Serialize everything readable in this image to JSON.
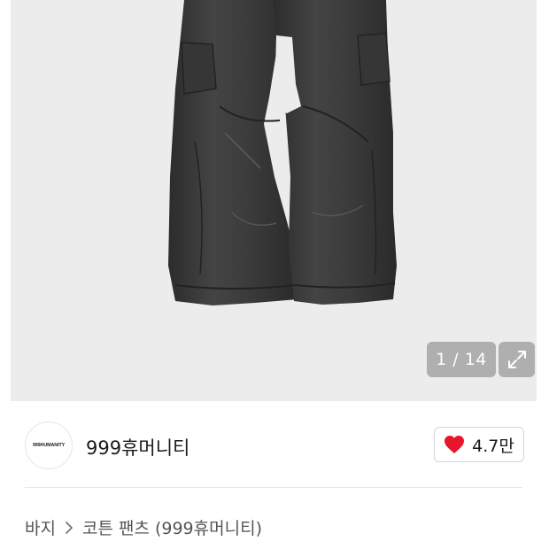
{
  "gallery": {
    "image_name": "product-photo-cargo-pants",
    "counter_current": "1",
    "counter_separator": "/",
    "counter_total": "14",
    "counter_text": "1 / 14",
    "expand_icon": "expand-icon"
  },
  "brand": {
    "logo_text": "999HUMANITY",
    "name": "999휴머니티"
  },
  "like": {
    "icon": "heart-icon",
    "color": "#e8162d",
    "count": "4.7만"
  },
  "breadcrumb": {
    "items": [
      "바지",
      "코튼 팬츠 (999휴머니티)"
    ],
    "separator_icon": "chevron-right-icon"
  }
}
